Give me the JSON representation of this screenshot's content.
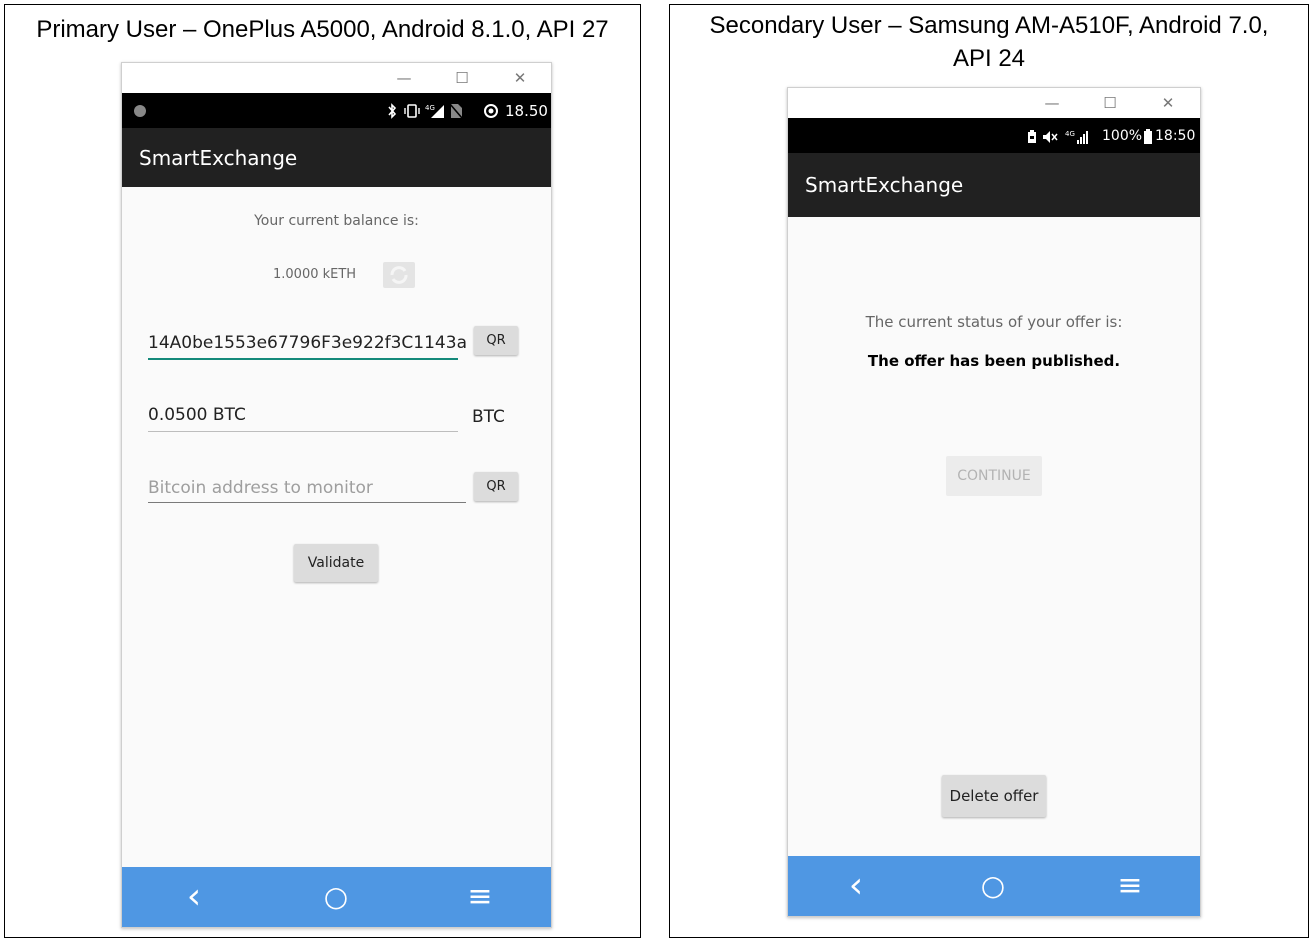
{
  "left_panel": {
    "title": "Primary User – OnePlus A5000, Android 8.1.0, API 27",
    "window": {
      "minimize": "—",
      "maximize": "☐",
      "close": "✕"
    },
    "status_bar": {
      "time": "18.50",
      "icons": [
        "camera-dot-icon",
        "bluetooth-icon",
        "vibrate-icon",
        "signal-4g-icon",
        "no-sim-icon",
        "data-saver-icon"
      ]
    },
    "app_title": "SmartExchange",
    "balance_label": "Your current balance is:",
    "balance_value": "1.0000 kETH",
    "eth_address_value": "14A0be1553e67796F3e922f3C1143a",
    "qr_label": "QR",
    "amount_value": "0.0500 BTC",
    "amount_unit": "BTC",
    "btc_address_placeholder": "Bitcoin address to monitor",
    "validate_label": "Validate",
    "nav": {
      "back": "‹",
      "home": "○",
      "menu": "≡"
    }
  },
  "right_panel": {
    "title": "Secondary User – Samsung AM-A510F, Android 7.0, API 24",
    "window": {
      "minimize": "—",
      "maximize": "☐",
      "close": "✕"
    },
    "status_bar": {
      "battery_percent": "100%",
      "time": "18:50",
      "icons": [
        "battery-saver-icon",
        "mute-icon",
        "signal-4g-icon",
        "battery-icon"
      ]
    },
    "app_title": "SmartExchange",
    "status_label": "The current status of your offer is:",
    "status_value": "The offer has been published.",
    "continue_label": "CONTINUE",
    "delete_label": "Delete offer",
    "nav": {
      "back": "‹",
      "home": "○",
      "menu": "≡"
    }
  },
  "colors": {
    "app_bar": "#212121",
    "nav_bar": "#4f97e3",
    "accent_underline": "#14897a",
    "button_gray": "#dcdcdc"
  }
}
